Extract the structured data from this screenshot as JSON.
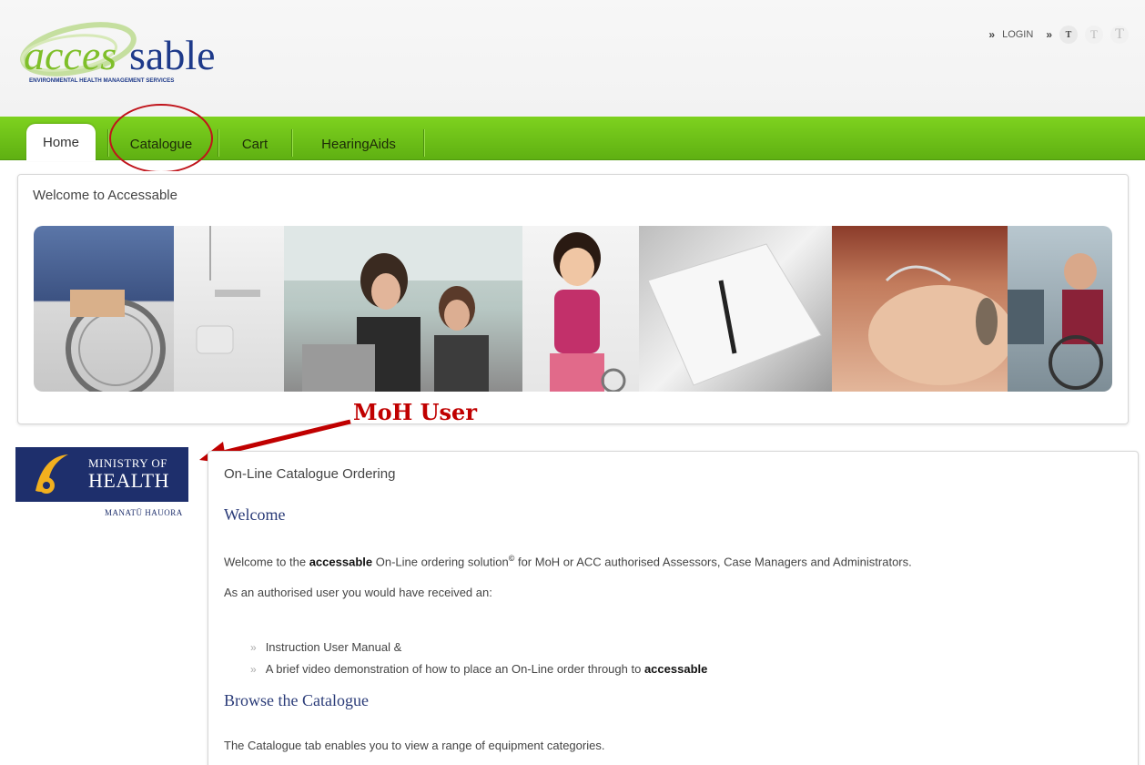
{
  "header": {
    "logo_text": "accessable",
    "logo_tagline": "ENVIRONMENTAL HEALTH MANAGEMENT SERVICES",
    "login_label": "LOGIN",
    "text_size_small": "T",
    "text_size_medium": "T",
    "text_size_large": "T"
  },
  "nav": {
    "tabs": [
      {
        "label": "Home",
        "active": true
      },
      {
        "label": "Catalogue",
        "active": false
      },
      {
        "label": "Cart",
        "active": false
      },
      {
        "label": "HearingAids",
        "active": false
      }
    ]
  },
  "welcome_panel": {
    "title": "Welcome to Accessable"
  },
  "annotation": {
    "label": "MoH User",
    "color": "#c00000"
  },
  "moh_logo": {
    "line1": "MINISTRY OF",
    "line2": "HEALTH",
    "subtitle": "MANATŪ HAUORA"
  },
  "content": {
    "title": "On-Line Catalogue Ordering",
    "welcome_heading": "Welcome",
    "welcome_text_pre": "Welcome to the ",
    "welcome_text_brand": "accessable",
    "welcome_text_mid": " On-Line ordering solution",
    "welcome_text_sup": "©",
    "welcome_text_post": " for MoH or ACC authorised Assessors, Case Managers and Administrators.",
    "received_text": "As an authorised user you would have received an:",
    "list_bullet": "»",
    "list_item_1": "Instruction User Manual &",
    "list_item_2_pre": "A brief video demonstration of how to place an On-Line order through to ",
    "list_item_2_brand": "accessable",
    "browse_heading": "Browse the Catalogue",
    "browse_text": "The Catalogue tab enables you to view a range of equipment categories."
  },
  "colors": {
    "nav_green": "#6cc11a",
    "brand_blue": "#1e2f6c",
    "heading_blue": "#2a3b78",
    "annotation_red": "#c00000"
  }
}
